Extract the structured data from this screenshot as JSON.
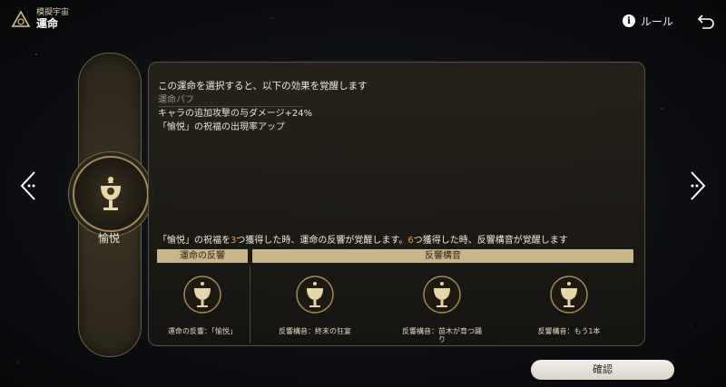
{
  "header": {
    "subtitle": "模擬宇宙",
    "title": "運命",
    "rule_label": "ルール"
  },
  "side": {
    "path_name": "愉悦"
  },
  "panel": {
    "heading": "この運命を選択すると、以下の効果を覚醒します",
    "buff_label": "運命バフ",
    "lines": [
      "キャラの追加攻撃の与ダメージ+24%",
      "「愉悦」の祝福の出現率アップ"
    ],
    "condition": {
      "p1": "「愉悦」の祝福を",
      "n1": "3",
      "p2": "つ獲得した時、運命の反響が覚醒します。",
      "n2": "6",
      "p3": "つ獲得した時、反響構音が覚醒します"
    },
    "col_left": "運命の反響",
    "col_right": "反響構音",
    "slots": [
      {
        "label": "運命の反響：「愉悦」",
        "icon": "chalice-icon"
      },
      {
        "label": "反響構音：終末の狂宴",
        "icon": "chalice-icon"
      },
      {
        "label": "反響構音：苗木が育つ踊り",
        "icon": "chalice-icon"
      },
      {
        "label": "反響構音：もう1本",
        "icon": "chalice-icon"
      }
    ]
  },
  "confirm_label": "確認",
  "colors": {
    "gold": "#c8b68a",
    "accent": "#f0913a"
  }
}
